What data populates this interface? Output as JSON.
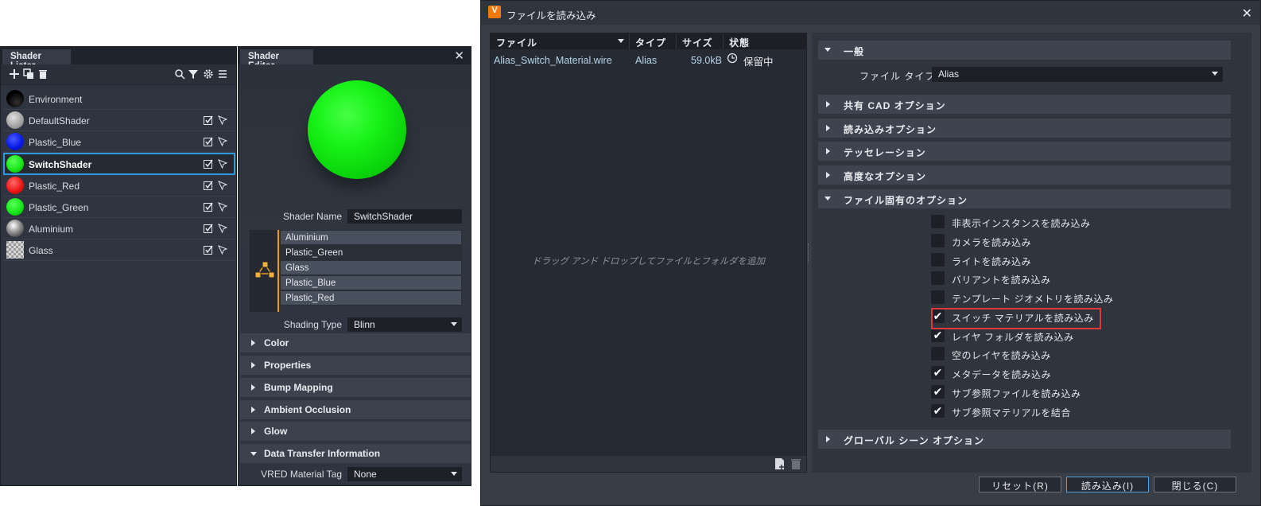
{
  "shader_lister": {
    "tab": "Shader Lister",
    "shaders": [
      {
        "name": "Environment",
        "color": "#000000",
        "has_actions": false
      },
      {
        "name": "DefaultShader",
        "color": "#b0b0b0",
        "has_actions": true
      },
      {
        "name": "Plastic_Blue",
        "color": "#0a1ae8",
        "has_actions": true
      },
      {
        "name": "SwitchShader",
        "color": "#18e818",
        "has_actions": true,
        "selected": true
      },
      {
        "name": "Plastic_Red",
        "color": "#ee1616",
        "has_actions": true
      },
      {
        "name": "Plastic_Green",
        "color": "#18e818",
        "has_actions": true
      },
      {
        "name": "Aluminium",
        "color": "#9a9a9a",
        "has_actions": true
      },
      {
        "name": "Glass",
        "color": "#c8c8c8",
        "has_actions": true
      }
    ]
  },
  "shader_editor": {
    "tab": "Shader Editor",
    "preview_color": "#18f318",
    "shader_name_label": "Shader Name",
    "shader_name_value": "SwitchShader",
    "switch_items": [
      "Aluminium",
      "Plastic_Green",
      "Glass",
      "Plastic_Blue",
      "Plastic_Red"
    ],
    "active_switch_item": "Plastic_Green",
    "shading_type_label": "Shading Type",
    "shading_type_value": "Blinn",
    "sections": [
      {
        "label": "Color",
        "open": false
      },
      {
        "label": "Properties",
        "open": false
      },
      {
        "label": "Bump Mapping",
        "open": false
      },
      {
        "label": "Ambient Occlusion",
        "open": false
      },
      {
        "label": "Glow",
        "open": false
      },
      {
        "label": "Data Transfer Information",
        "open": true
      }
    ],
    "vred_tag_label": "VRED Material Tag",
    "vred_tag_value": "None"
  },
  "dialog": {
    "title": "ファイルを読み込み",
    "app_icon_letter": "V",
    "columns": {
      "file": "ファイル",
      "type": "タイプ",
      "size": "サイズ",
      "status": "状態"
    },
    "files": [
      {
        "file": "Alias_Switch_Material.wire",
        "type": "Alias",
        "size": "59.0kB",
        "status": "保留中"
      }
    ],
    "drop_hint": "ドラッグ アンド ドロップしてファイルとフォルダを追加",
    "general": {
      "label": "一般",
      "file_type_label": "ファイル タイプ",
      "file_type_value": "Alias"
    },
    "collapsed_sections": [
      "共有 CAD オプション",
      "読み込みオプション",
      "テッセレーション",
      "高度なオプション"
    ],
    "file_specific": {
      "label": "ファイル固有のオプション",
      "options": [
        {
          "label": "非表示インスタンスを読み込み",
          "checked": false
        },
        {
          "label": "カメラを読み込み",
          "checked": false
        },
        {
          "label": "ライトを読み込み",
          "checked": false
        },
        {
          "label": "バリアントを読み込み",
          "checked": false
        },
        {
          "label": "テンプレート ジオメトリを読み込み",
          "checked": false
        },
        {
          "label": "スイッチ マテリアルを読み込み",
          "checked": true,
          "highlighted": true
        },
        {
          "label": "レイヤ フォルダを読み込み",
          "checked": true
        },
        {
          "label": "空のレイヤを読み込み",
          "checked": false
        },
        {
          "label": "メタデータを読み込み",
          "checked": true
        },
        {
          "label": "サブ参照ファイルを読み込み",
          "checked": true
        },
        {
          "label": "サブ参照マテリアルを結合",
          "checked": true
        }
      ]
    },
    "global_scene": {
      "label": "グローバル シーン オプション"
    },
    "buttons": {
      "reset": "リセット(R)",
      "import": "読み込み(I)",
      "close": "閉じる(C)"
    },
    "highlight_color": "#e0393b",
    "checkmark_glyph": "✔"
  }
}
